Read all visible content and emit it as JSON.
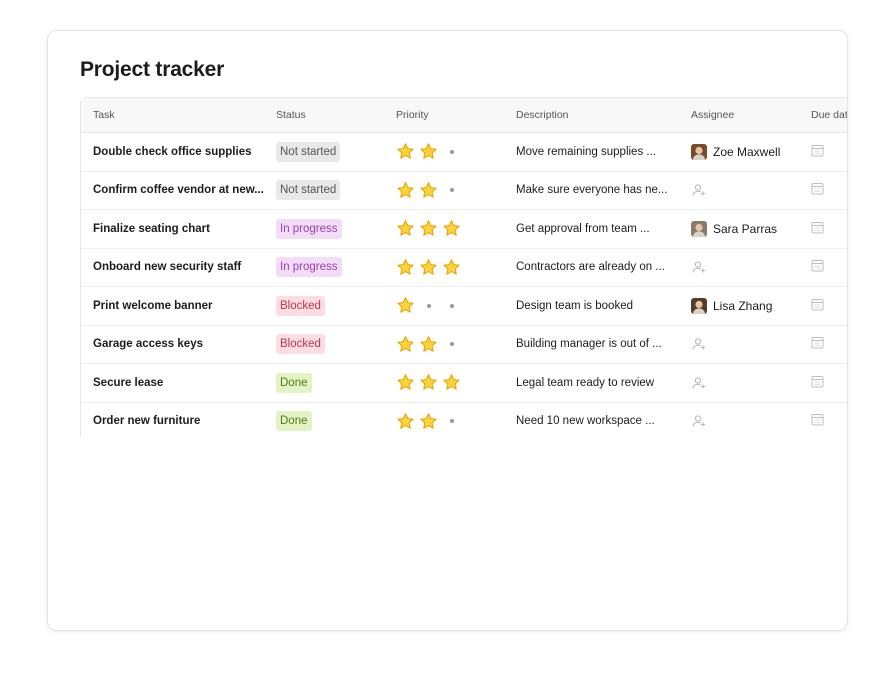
{
  "title": "Project tracker",
  "columns": [
    "Task",
    "Status",
    "Priority",
    "Description",
    "Assignee",
    "Due dat"
  ],
  "status_colors": {
    "Not started": {
      "bg": "#e8e8e8",
      "fg": "#555555"
    },
    "In progress": {
      "bg": "#f2dcf7",
      "fg": "#9b3fb3"
    },
    "Blocked": {
      "bg": "#fbdde2",
      "fg": "#c0344f"
    },
    "Done": {
      "bg": "#e3f3c4",
      "fg": "#4f7a17"
    }
  },
  "rows": [
    {
      "task": "Double check office supplies",
      "status": "Not started",
      "priority": 2,
      "description": "Move remaining supplies ...",
      "assignee": "Zoe Maxwell",
      "avatar_color": "#7a4a2a"
    },
    {
      "task": "Confirm coffee vendor at new...",
      "status": "Not started",
      "priority": 2,
      "description": "Make sure everyone has ne...",
      "assignee": "",
      "avatar_color": ""
    },
    {
      "task": "Finalize seating chart",
      "status": "In progress",
      "priority": 3,
      "description": "Get approval from team ...",
      "assignee": "Sara Parras",
      "avatar_color": "#8a7a6a"
    },
    {
      "task": "Onboard new security staff",
      "status": "In progress",
      "priority": 3,
      "description": "Contractors are already on ...",
      "assignee": "",
      "avatar_color": ""
    },
    {
      "task": "Print welcome banner",
      "status": "Blocked",
      "priority": 1,
      "description": "Design team is booked",
      "assignee": "Lisa Zhang",
      "avatar_color": "#5a3a2a"
    },
    {
      "task": "Garage access keys",
      "status": "Blocked",
      "priority": 2,
      "description": "Building manager is out of ...",
      "assignee": "",
      "avatar_color": ""
    },
    {
      "task": "Secure lease",
      "status": "Done",
      "priority": 3,
      "description": "Legal team ready to review",
      "assignee": "",
      "avatar_color": ""
    },
    {
      "task": "Order new furniture",
      "status": "Done",
      "priority": 2,
      "description": "Need 10 new workspace ...",
      "assignee": "",
      "avatar_color": ""
    }
  ],
  "icons": {
    "star": "star-icon",
    "empty_assignee": "person-add-icon",
    "date": "calendar-icon"
  }
}
